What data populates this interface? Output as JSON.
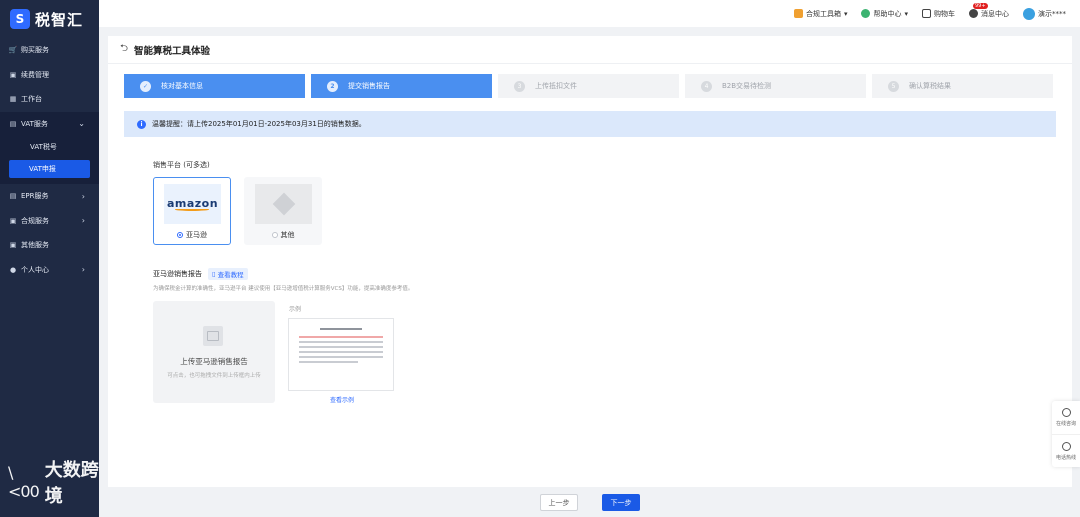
{
  "brand": {
    "logo_char": "S",
    "name": "税智汇"
  },
  "sidebar": {
    "items": [
      {
        "label": "购买服务",
        "icon": "cart-icon",
        "glyph": "🛒"
      },
      {
        "label": "续费管理",
        "icon": "calendar-icon",
        "glyph": "▣"
      },
      {
        "label": "工作台",
        "icon": "grid-icon",
        "glyph": "▦"
      },
      {
        "label": "VAT服务",
        "icon": "vat-icon",
        "glyph": "▤",
        "chevron": "⌄"
      }
    ],
    "sub_items": [
      {
        "label": "VAT税号"
      },
      {
        "label": "VAT申报"
      }
    ],
    "items2": [
      {
        "label": "EPR服务",
        "icon": "epr-icon",
        "glyph": "▤",
        "chevron": "›"
      },
      {
        "label": "合规服务",
        "icon": "compliance-icon",
        "glyph": "▣",
        "chevron": "›"
      },
      {
        "label": "其他服务",
        "icon": "other-service-icon",
        "glyph": "▣"
      },
      {
        "label": "个人中心",
        "icon": "user-icon",
        "glyph": "●",
        "chevron": "›"
      }
    ],
    "watermark": "大数跨境",
    "watermark_logo": "\\<00"
  },
  "topbar": {
    "tools": "合规工具箱",
    "help": "帮助中心",
    "cart": "购物车",
    "messages": "消息中心",
    "messages_badge": "99+",
    "user": "演示****",
    "caret": "▾"
  },
  "page": {
    "back": "⮌",
    "title": "智能算税工具体验"
  },
  "steps": [
    {
      "num": "✓",
      "label": "核对基本信息",
      "state": "done"
    },
    {
      "num": "2",
      "label": "提交销售报告",
      "state": "active"
    },
    {
      "num": "3",
      "label": "上传抵扣文件",
      "state": "todo"
    },
    {
      "num": "4",
      "label": "B2B交易待检测",
      "state": "todo"
    },
    {
      "num": "5",
      "label": "确认算税结果",
      "state": "todo"
    }
  ],
  "tip": {
    "icon": "i",
    "text": "温馨提醒：请上传2025年01月01日-2025年03月31日的销售数据。"
  },
  "platform": {
    "label": "销售平台 (可多选)",
    "options": [
      {
        "name": "亚马逊",
        "logo": "amazon",
        "selected": true
      },
      {
        "name": "其他",
        "selected": false
      }
    ]
  },
  "report": {
    "title": "亚马逊销售报告",
    "tutorial": "查看教程",
    "tutorial_icon": "▯",
    "desc": "为确保税金计算的准确性，亚马逊平台 建议使用【亚马逊增值税计算服务VCS】功能，提高准确度参考值。",
    "upload_main": "上传亚马逊销售报告",
    "upload_sub": "可点击，也可拖拽文件到上传框内上传",
    "example_label": "示例",
    "example_link": "查看示例"
  },
  "footer": {
    "prev": "上一步",
    "next": "下一步"
  },
  "float": {
    "chat": "在线咨询",
    "phone": "电话热线"
  },
  "colors": {
    "sidebar_bg": "#1f2a44",
    "primary": "#1a5ae6",
    "step_active": "#4a8ff0",
    "tip_bg": "#dbe8fb"
  }
}
